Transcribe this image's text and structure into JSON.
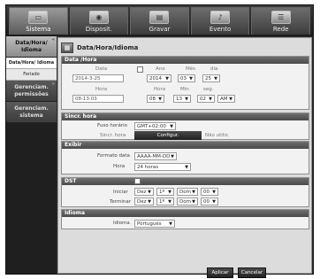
{
  "tabs": [
    {
      "label": "Sistema",
      "icon": "monitor-icon",
      "active": true
    },
    {
      "label": "Disposit.",
      "icon": "camera-icon",
      "active": false
    },
    {
      "label": "Gravar",
      "icon": "film-icon",
      "active": false
    },
    {
      "label": "Evento",
      "icon": "bell-icon",
      "active": false
    },
    {
      "label": "Rede",
      "icon": "network-icon",
      "active": false
    }
  ],
  "sidebar": {
    "main1": "Data/Hora/ Idioma",
    "sub1": "Data/Hora/ Idioma",
    "sub2": "Feriado",
    "main2": "Gerenciam. permissões",
    "main3": "Gerenciam. sistema"
  },
  "panel": {
    "title": "Data/Hora/Idioma",
    "datahora": {
      "header": "Data /Hora",
      "data_label": "Data",
      "data_value": "2014-3-25",
      "ano_label": "Ano",
      "mes_label": "Mês",
      "dia_label": "dia",
      "ano_value": "2014",
      "mes_value": "03",
      "dia_value": "25",
      "hora_label": "Hora",
      "hora_value": "08:13:03",
      "hora_sel_label": "Hora",
      "min_label": "Min",
      "seg_label": "seg.",
      "h_value": "08",
      "m_value": "13",
      "s_value": "02",
      "ampm_value": "AM"
    },
    "sincr": {
      "header": "Sincr. hora",
      "fuso_label": "Fuso horário",
      "fuso_value": "GMT+02:00",
      "sincr_label": "Sincr. hora",
      "config_button": "Configur.",
      "status": "Não utiliz."
    },
    "exibir": {
      "header": "Exibir",
      "formato_label": "Formato data",
      "formato_value": "AAAA-MM-DD",
      "hora_label": "Hora",
      "hora_value": "24 horas"
    },
    "dst": {
      "header": "DST",
      "iniciar_label": "Iniciar",
      "terminar_label": "Terminar",
      "ini_mes": "Dez",
      "ini_sem": "1º",
      "ini_dia": "Dom",
      "ini_hora": "00",
      "ter_mes": "Dez",
      "ter_sem": "1º",
      "ter_dia": "Dom",
      "ter_hora": "00"
    },
    "idioma": {
      "header": "Idioma",
      "label": "Idioma",
      "value": "Português"
    },
    "buttons": {
      "apply": "Aplicar",
      "cancel": "Cancelar"
    }
  }
}
